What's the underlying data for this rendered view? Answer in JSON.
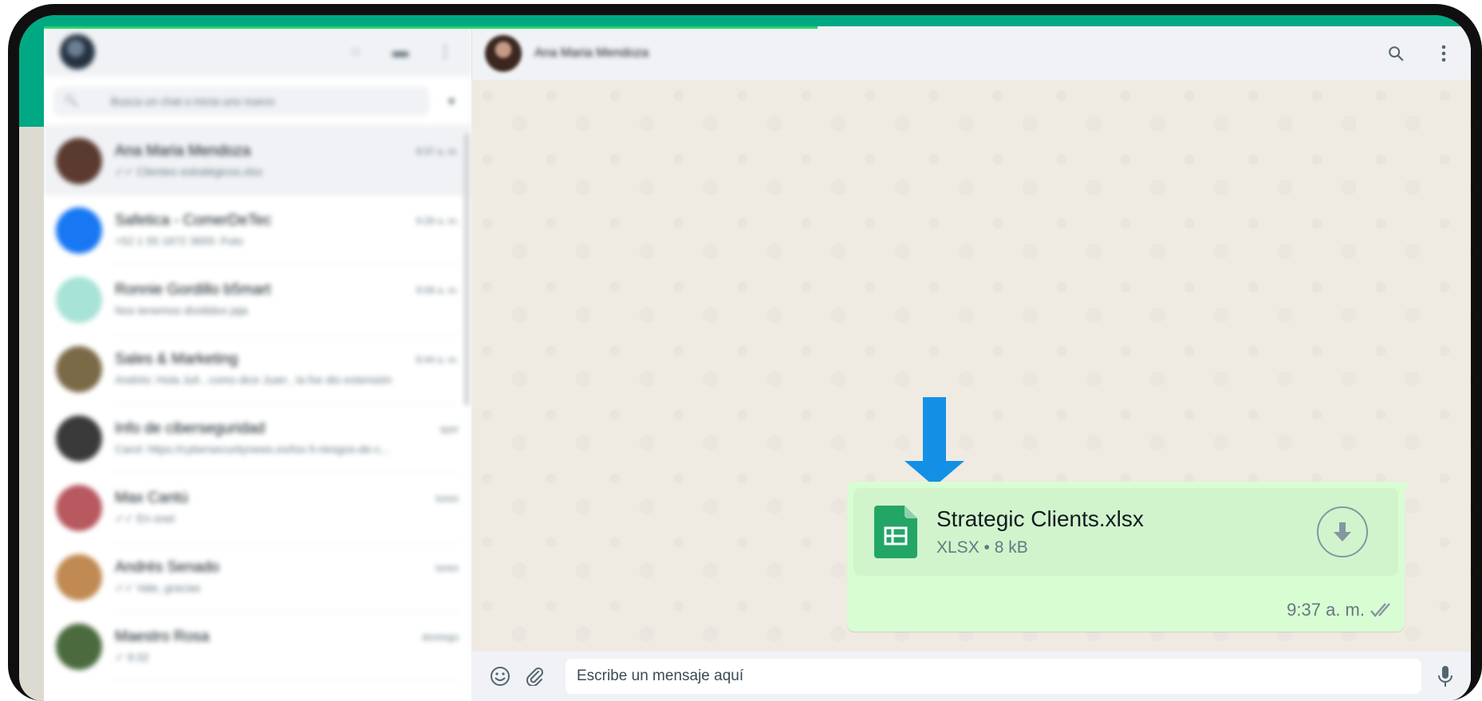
{
  "colors": {
    "brand_green": "#00a884",
    "outgoing_bubble": "#d9fdd3",
    "file_card": "#d1f4cc",
    "sheets_green": "#23a566",
    "arrow_blue": "#1390e5",
    "chat_background": "#efeae2"
  },
  "sidebar": {
    "header_icons": [
      "status-icon",
      "new-chat-icon",
      "menu-icon"
    ],
    "search": {
      "placeholder": "Busca un chat o inicia uno nuevo",
      "icon": "search-icon",
      "filter_icon": "filter-icon"
    },
    "chats": [
      {
        "name": "Ana Maria Mendoza",
        "time": "9:37 a. m.",
        "preview": "✓✓ Clientes estratégicos.xlsx",
        "active": true,
        "avatar_color": "#5b3a30"
      },
      {
        "name": "Safetica - ComerDeTec",
        "time": "9:28 a. m.",
        "preview": "+52 1 55 1872 3655: Foto",
        "active": false,
        "avatar_color": "#1877f2"
      },
      {
        "name": "Ronnie Gordillo b5mart",
        "time": "9:08 a. m.",
        "preview": "Nos tenemos divididos jaja",
        "active": false,
        "avatar_color": "#a7e3d6"
      },
      {
        "name": "Sales & Marketing",
        "time": "8:44 a. m.",
        "preview": "Andrés: Hola Juli , como dice Juan , la fxe dio extensión",
        "active": false,
        "avatar_color": "#7a6a48"
      },
      {
        "name": "Info de ciberseguridad",
        "time": "ayer",
        "preview": "Carol: https://cybersecuritynews.es/los-5-riesgos-de-c...",
        "active": false,
        "avatar_color": "#3a3a3a"
      },
      {
        "name": "Max Cantú",
        "time": "lunes",
        "preview": "✓✓ En onel",
        "active": false,
        "avatar_color": "#b8585f"
      },
      {
        "name": "Andrés Senado",
        "time": "lunes",
        "preview": "✓✓ Vale, gracias",
        "active": false,
        "avatar_color": "#c08a52"
      },
      {
        "name": "Maestro Rosa",
        "time": "domingo",
        "preview": "✓ 9:32",
        "active": false,
        "avatar_color": "#4b6b3f"
      }
    ]
  },
  "conversation": {
    "contact_name": "Ana Maria Mendoza",
    "header_icons": [
      "search-icon",
      "menu-icon"
    ],
    "message": {
      "file_name": "Strategic Clients.xlsx",
      "file_type": "XLSX",
      "separator": "•",
      "file_size": "8 kB",
      "time": "9:37 a. m.",
      "status_icon": "double-check-icon"
    },
    "composer": {
      "placeholder": "Escribe un mensaje aquí",
      "icons": [
        "emoji-icon",
        "attach-icon",
        "mic-icon"
      ]
    }
  }
}
